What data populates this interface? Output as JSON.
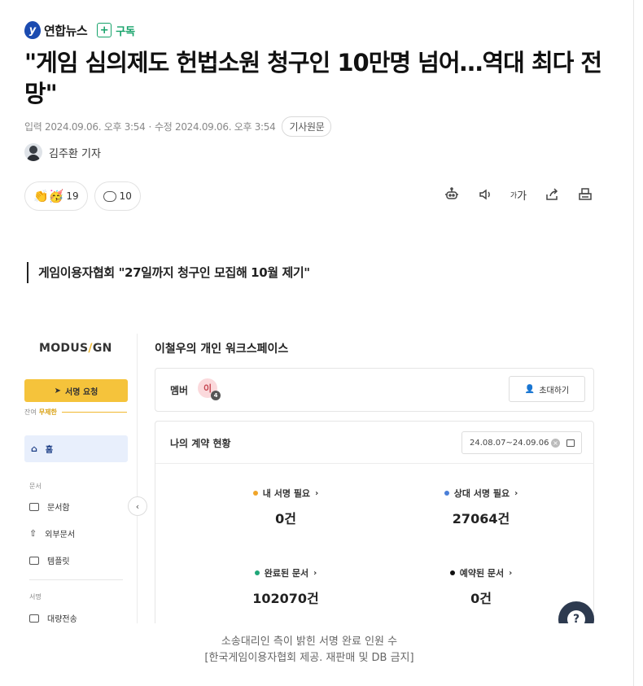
{
  "publisher": {
    "logo_glyph": "y",
    "name": "연합뉴스",
    "subscribe_label": "구독",
    "accent": "#16a36a"
  },
  "article": {
    "title": "\"게임 심의제도 헌법소원 청구인 10만명 넘어…역대 최다 전망\"",
    "input_time": "입력 2024.09.06. 오후 3:54",
    "modified_time": "수정 2024.09.06. 오후 3:54",
    "original_button": "기사원문",
    "author": "김주환 기자",
    "subheading": "게임이용자협회 \"27일까지 청구인 모집해 10월 제기\""
  },
  "reactions": {
    "emoji": "👏🥳",
    "count": "19",
    "comment_count": "10"
  },
  "tools": [
    "robot-summary",
    "audio",
    "font-size",
    "share",
    "print"
  ],
  "font_tool": {
    "small": "가",
    "large": "가"
  },
  "screenshot": {
    "brand_left": "MODUS",
    "brand_slash": "/",
    "brand_right": "GN",
    "sign_button": "서명 요청",
    "remain_label": "잔여",
    "remain_value": "무제한",
    "home": "홈",
    "section_docs": "문서",
    "docs_items": [
      "문서함",
      "외부문서",
      "템플릿"
    ],
    "section_sign": "서명",
    "sign_items": [
      "대량전송"
    ],
    "workspace_title": "이철우의 개인 워크스페이스",
    "member_label": "멤버",
    "member_chip": "이",
    "member_badge": "4",
    "invite_button": "초대하기",
    "contract_title": "나의 계약 현황",
    "date_range": "24.08.07~24.09.06",
    "stats": [
      {
        "label": "내 서명 필요",
        "value": "0건",
        "color": "#f0a52a"
      },
      {
        "label": "상대 서명 필요",
        "value": "27064건",
        "color": "#4a7fd8"
      },
      {
        "label": "완료된 문서",
        "value": "102070건",
        "color": "#1fa779"
      },
      {
        "label": "예약된 문서",
        "value": "0건",
        "color": "#111111"
      }
    ]
  },
  "caption": {
    "line1": "소송대리인 측이 밝힌 서명 완료 인원 수",
    "line2": "[한국게임이용자협회 제공. 재판매 및 DB 금지]"
  }
}
